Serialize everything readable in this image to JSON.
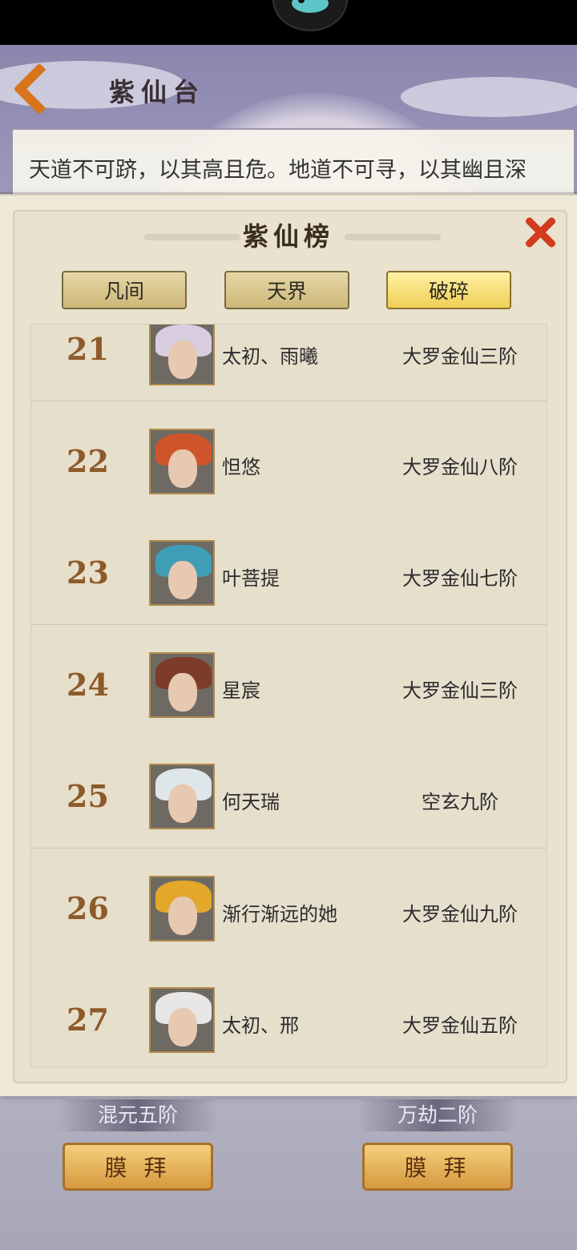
{
  "page": {
    "title": "紫仙台",
    "intro": "天道不可跻，以其高且危。地道不可寻，以其幽且深"
  },
  "modal": {
    "title": "紫仙榜",
    "tabs": [
      {
        "label": "凡间",
        "active": false
      },
      {
        "label": "天界",
        "active": false
      },
      {
        "label": "破碎",
        "active": true
      }
    ]
  },
  "ranking": [
    {
      "rank": "21",
      "name": "太初、雨曦",
      "realm": "大罗金仙三阶",
      "avatar_hair": "#d9cde0"
    },
    {
      "rank": "22",
      "name": "怛悠",
      "realm": "大罗金仙八阶",
      "avatar_hair": "#d0542a"
    },
    {
      "rank": "23",
      "name": "叶菩提",
      "realm": "大罗金仙七阶",
      "avatar_hair": "#3f9db5"
    },
    {
      "rank": "24",
      "name": "星宸",
      "realm": "大罗金仙三阶",
      "avatar_hair": "#7d3b2a"
    },
    {
      "rank": "25",
      "name": "何天瑞",
      "realm": "空玄九阶",
      "avatar_hair": "#dfe6ea"
    },
    {
      "rank": "26",
      "name": "渐行渐远的她",
      "realm": "大罗金仙九阶",
      "avatar_hair": "#e3a72a"
    },
    {
      "rank": "27",
      "name": "太初、邢",
      "realm": "大罗金仙五阶",
      "avatar_hair": "#e8e6e6"
    }
  ],
  "bottom": {
    "left_rank": "混元五阶",
    "right_rank": "万劫二阶",
    "worship_label": "膜 拜"
  },
  "colors": {
    "accent_gold": "#efcf55",
    "rank_brown": "#8e5a2a",
    "close_red": "#d33a1e"
  }
}
